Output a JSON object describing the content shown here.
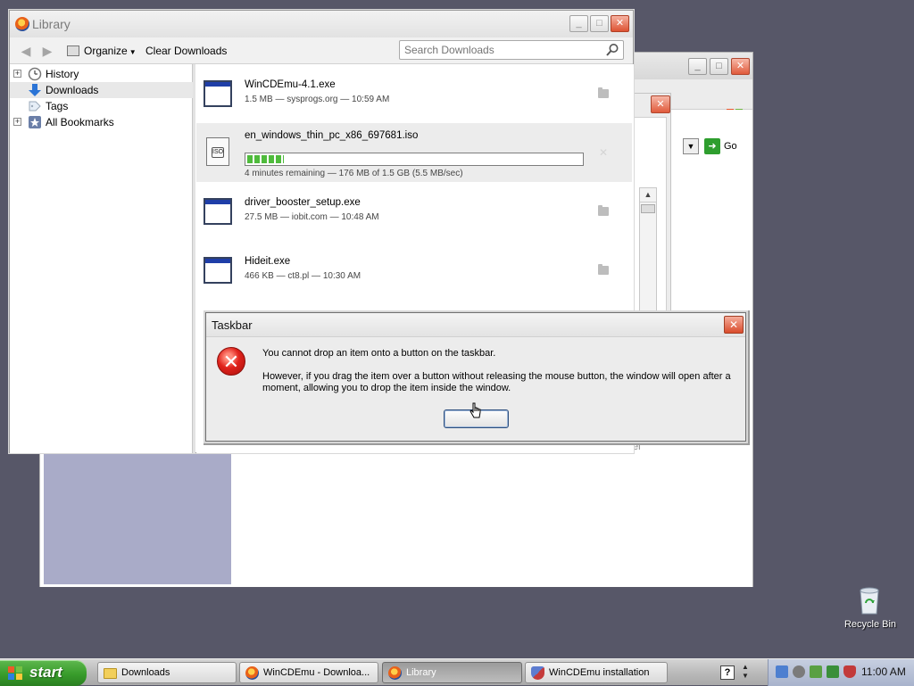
{
  "library": {
    "title": "Library",
    "toolbar": {
      "organize": "Organize",
      "clear_downloads": "Clear Downloads",
      "search_placeholder": "Search Downloads"
    },
    "sidebar": [
      {
        "label": "History",
        "icon": "clock-icon",
        "expandable": true
      },
      {
        "label": "Downloads",
        "icon": "download-arrow-icon",
        "expandable": false,
        "selected": true
      },
      {
        "label": "Tags",
        "icon": "tag-icon",
        "expandable": false
      },
      {
        "label": "All Bookmarks",
        "icon": "bookmarks-star-icon",
        "expandable": true
      }
    ],
    "downloads": [
      {
        "name": "WinCDEmu-4.1.exe",
        "meta": "1.5 MB — sysprogs.org — 10:59 AM",
        "state": "complete"
      },
      {
        "name": "en_windows_thin_pc_x86_697681.iso",
        "meta": "4 minutes remaining — 176 MB of 1.5 GB (5.5 MB/sec)",
        "state": "downloading",
        "progress_percent": 11
      },
      {
        "name": "driver_booster_setup.exe",
        "meta": "27.5 MB — iobit.com — 10:48 AM",
        "state": "complete"
      },
      {
        "name": "Hideit.exe",
        "meta": "466 KB — ct8.pl — 10:30 AM",
        "state": "complete"
      }
    ],
    "iso_disc_label": "ISO"
  },
  "dialog": {
    "title": "Taskbar",
    "message1": "You cannot drop an item onto a button on the taskbar.",
    "message2": "However, if you drag the item over a button without releasing the mouse button, the window will open after a moment, allowing you to drop the item inside the window.",
    "ok_label": ""
  },
  "background_window": {
    "go_label": "Go",
    "fragment_text": "el"
  },
  "desktop": {
    "recycle_bin": "Recycle Bin"
  },
  "taskbar": {
    "start_label": "start",
    "buttons": [
      {
        "label": "Downloads",
        "icon": "folder-icon",
        "active": false
      },
      {
        "label": "WinCDEmu - Downloa...",
        "icon": "firefox-icon",
        "active": false
      },
      {
        "label": "Library",
        "icon": "firefox-icon",
        "active": true
      },
      {
        "label": "WinCDEmu installation",
        "icon": "shield-icon",
        "active": false
      }
    ],
    "clock": "11:00 AM"
  },
  "colors": {
    "desktop": "#575768",
    "progress_green": "#4fbb3c",
    "start_green": "#389c2b",
    "error_red": "#e0221b"
  }
}
